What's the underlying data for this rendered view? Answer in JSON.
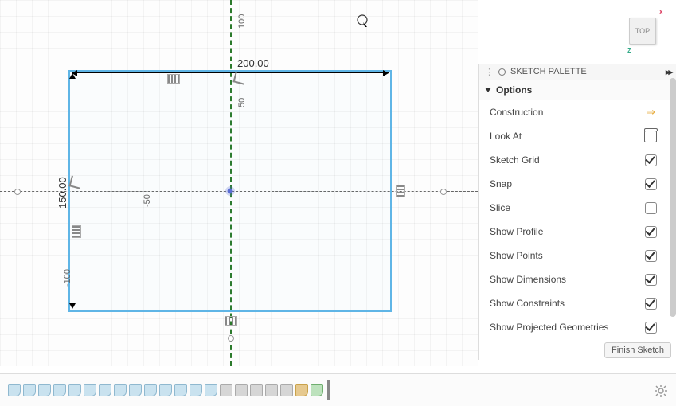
{
  "viewcube": {
    "label": "TOP",
    "axis_x": "X",
    "axis_z": "Z"
  },
  "canvas": {
    "dim_width": "200.00",
    "dim_height": "150.00",
    "ticks": {
      "neg100": "-100",
      "neg50": "-50",
      "pos50": "50",
      "pos100": "100"
    }
  },
  "palette": {
    "title": "SKETCH PALETTE",
    "options_label": "Options",
    "options": [
      {
        "label": "Construction",
        "control": "icon-construction"
      },
      {
        "label": "Look At",
        "control": "icon-lookat"
      },
      {
        "label": "Sketch Grid",
        "control": "check",
        "checked": true
      },
      {
        "label": "Snap",
        "control": "check",
        "checked": true
      },
      {
        "label": "Slice",
        "control": "check",
        "checked": false
      },
      {
        "label": "Show Profile",
        "control": "check",
        "checked": true
      },
      {
        "label": "Show Points",
        "control": "check",
        "checked": true
      },
      {
        "label": "Show Dimensions",
        "control": "check",
        "checked": true
      },
      {
        "label": "Show Constraints",
        "control": "check",
        "checked": true
      },
      {
        "label": "Show Projected Geometries",
        "control": "check",
        "checked": true
      }
    ]
  },
  "finish_label": "Finish Sketch",
  "timeline": {
    "items": [
      {
        "kind": "sketch"
      },
      {
        "kind": "sketch"
      },
      {
        "kind": "sketch"
      },
      {
        "kind": "sketch"
      },
      {
        "kind": "sketch"
      },
      {
        "kind": "sketch"
      },
      {
        "kind": "sketch"
      },
      {
        "kind": "sketch"
      },
      {
        "kind": "sketch"
      },
      {
        "kind": "sketch"
      },
      {
        "kind": "sketch"
      },
      {
        "kind": "sketch"
      },
      {
        "kind": "sketch"
      },
      {
        "kind": "sketch"
      },
      {
        "kind": "feat"
      },
      {
        "kind": "feat"
      },
      {
        "kind": "feat"
      },
      {
        "kind": "feat"
      },
      {
        "kind": "feat"
      },
      {
        "kind": "plane"
      },
      {
        "kind": "active"
      }
    ]
  }
}
